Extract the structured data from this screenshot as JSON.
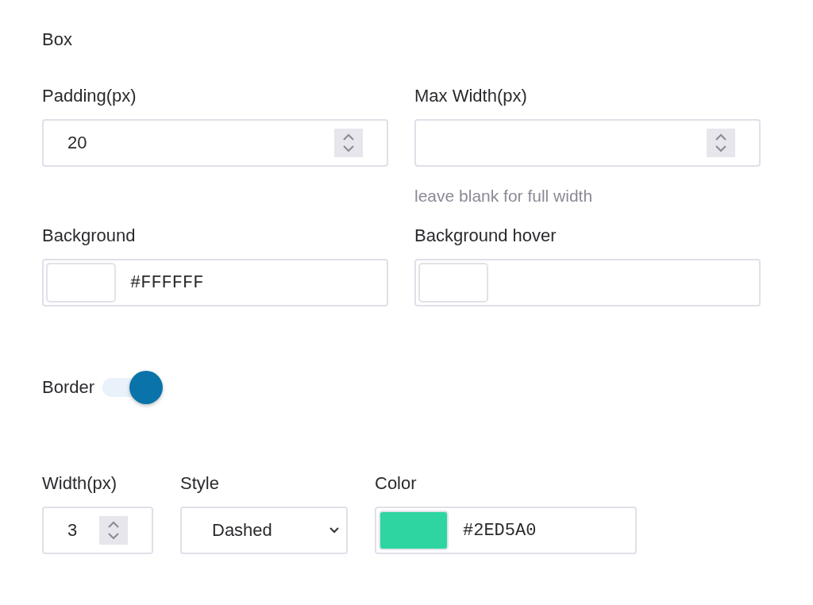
{
  "section_title": "Box",
  "fields": [
    {
      "kind": "number",
      "label": "Padding(px)",
      "value": "20"
    },
    {
      "kind": "number",
      "label": "Max Width(px)",
      "hint": "leave blank for full width"
    },
    {
      "kind": "color",
      "label": "Background",
      "color": "#ffffff",
      "value": "#FFFFFF"
    },
    {
      "kind": "color",
      "label": "Background hover",
      "color": "#ffffff"
    }
  ],
  "border": {
    "label": "Border",
    "on": true
  },
  "border_fields": [
    {
      "kind": "number",
      "label": "Width(px)",
      "value": "3"
    },
    {
      "kind": "select",
      "label": "Style",
      "value": "Dashed"
    },
    {
      "kind": "color",
      "label": "Color",
      "color": "#2ed5a0",
      "value": "#2ED5A0"
    }
  ]
}
